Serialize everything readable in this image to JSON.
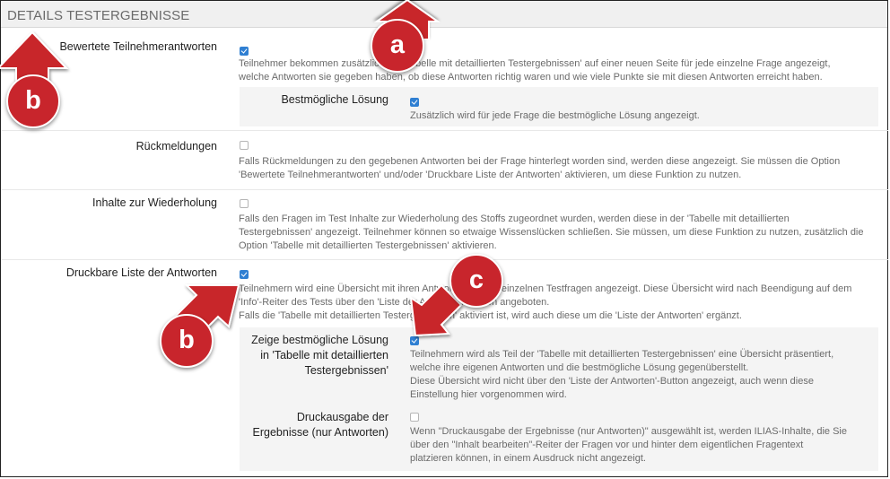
{
  "section": {
    "title": "DETAILS TESTERGEBNISSE"
  },
  "rows": [
    {
      "label": "Bewertete Teilnehmerantworten",
      "checked": true,
      "desc": [
        "Teilnehmer bekommen zusätzlich die 'Tabelle mit detaillierten Testergebnissen' auf einer neuen Seite für jede einzelne Frage angezeigt,",
        "welche Antworten sie gegeben haben, ob diese Antworten richtig waren und wie viele Punkte sie mit diesen Antworten erreicht haben."
      ]
    },
    {
      "label": "Rückmeldungen",
      "checked": false,
      "desc": [
        "Falls Rückmeldungen zu den gegebenen Antworten bei der Frage hinterlegt worden sind, werden diese angezeigt. Sie müssen die Option",
        "'Bewertete Teilnehmerantworten' und/oder 'Druckbare Liste der Antworten' aktivieren, um diese Funktion zu nutzen."
      ]
    },
    {
      "label": "Inhalte zur Wiederholung",
      "checked": false,
      "desc": [
        "Falls den Fragen im Test Inhalte zur Wiederholung des Stoffs zugeordnet wurden, werden diese in der 'Tabelle mit detaillierten",
        "Testergebnissen' angezeigt. Teilnehmer können so etwaige Wissenslücken schließen. Sie müssen, um diese Funktion zu nutzen, zusätzlich die",
        "Option 'Tabelle mit detaillierten Testergebnissen' aktivieren."
      ]
    },
    {
      "label": "Druckbare Liste der Antworten",
      "checked": true,
      "desc": [
        "Teilnehmern wird eine Übersicht mit ihren Antworten zu den einzelnen Testfragen angezeigt. Diese Übersicht wird nach Beendigung auf dem",
        "'Info'-Reiter des Tests über den 'Liste der Antworten'-Button angeboten.",
        "Falls die 'Tabelle mit detaillierten Testergebnissen' aktiviert ist, wird auch diese um die 'Liste der Antworten' ergänzt."
      ]
    }
  ],
  "subrows": [
    {
      "label": "Bestmögliche Lösung",
      "checked": true,
      "desc": [
        "Zusätzlich wird für jede Frage die bestmögliche Lösung angezeigt."
      ]
    },
    {
      "label": [
        "Zeige bestmögliche Lösung",
        "in 'Tabelle mit detaillierten",
        "Testergebnissen'"
      ],
      "checked": true,
      "desc": [
        "Teilnehmern wird als Teil der 'Tabelle mit detaillierten Testergebnissen' eine Übersicht präsentiert,",
        "welche ihre eigenen Antworten und die bestmögliche Lösung gegenüberstellt.",
        "Diese Übersicht wird nicht über den 'Liste der Antworten'-Button angezeigt, auch wenn diese",
        "Einstellung hier vorgenommen wird."
      ]
    },
    {
      "label": [
        "Druckausgabe der",
        "Ergebnisse (nur Antworten)"
      ],
      "checked": false,
      "desc": [
        "Wenn \"Druckausgabe der Ergebnisse (nur Antworten)\" ausgewählt ist, werden ILIAS-Inhalte, die Sie",
        "über den \"Inhalt bearbeiten\"-Reiter der Fragen vor und hinter dem eigentlichen Fragentext",
        "platzieren können, in einem Ausdruck nicht angezeigt."
      ]
    }
  ],
  "markers": {
    "a": "a",
    "b1": "b",
    "b2": "b",
    "c": "c"
  },
  "colors": {
    "marker": "#c8252c",
    "checkbox": "#2f7fd2"
  }
}
